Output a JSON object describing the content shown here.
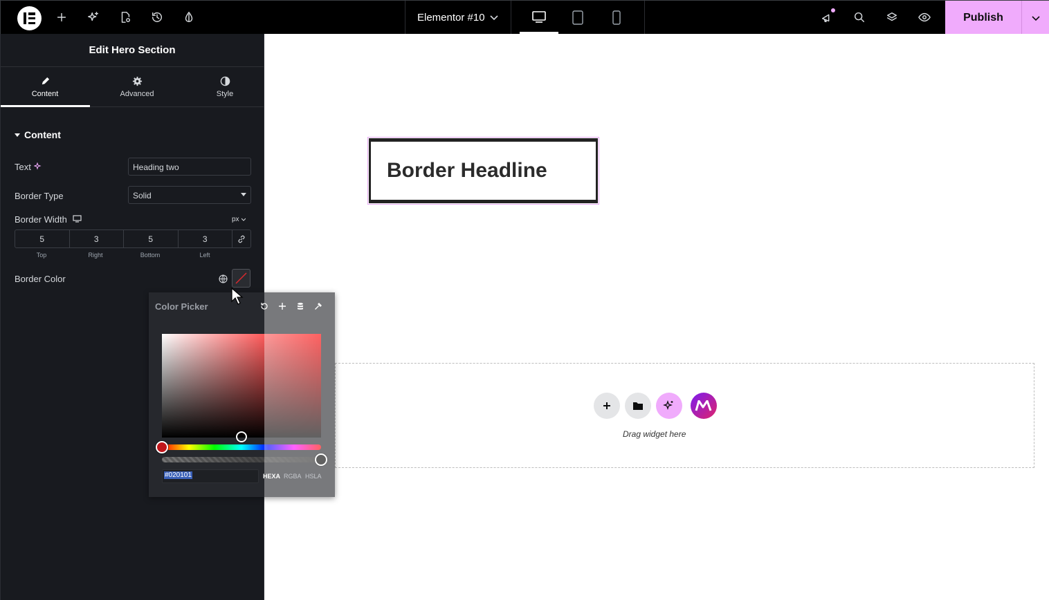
{
  "topbar": {
    "document_title": "Elementor #10",
    "publish_label": "Publish",
    "icons": [
      "elementor-logo-icon",
      "add-element-icon",
      "ai-sparkle-icon",
      "page-settings-icon",
      "history-icon",
      "theme-style-icon",
      "whats-new-icon",
      "search-icon",
      "structure-icon",
      "preview-icon"
    ],
    "devices": [
      "desktop-icon",
      "tablet-icon",
      "mobile-icon"
    ]
  },
  "panel": {
    "title": "Edit Hero Section",
    "tabs": [
      {
        "label": "Content"
      },
      {
        "label": "Advanced"
      },
      {
        "label": "Style"
      }
    ],
    "section_title": "Content",
    "text_label": "Text",
    "text_value": "Heading two",
    "border_type_label": "Border Type",
    "border_type_value": "Solid",
    "border_width_label": "Border Width",
    "unit": "px",
    "dims": [
      {
        "value": "5",
        "label": "Top"
      },
      {
        "value": "3",
        "label": "Right"
      },
      {
        "value": "5",
        "label": "Bottom"
      },
      {
        "value": "3",
        "label": "Left"
      }
    ],
    "border_color_label": "Border Color"
  },
  "color_picker": {
    "title": "Color Picker",
    "hex_value": "#020101",
    "formats": [
      "HEXA",
      "RGBA",
      "HSLA"
    ],
    "active_format": "HEXA"
  },
  "canvas": {
    "headline": "Border Headline",
    "dropzone_text": "Drag widget here",
    "colors": {
      "accent": "#f0abfc",
      "headline_border": "#222222"
    }
  }
}
